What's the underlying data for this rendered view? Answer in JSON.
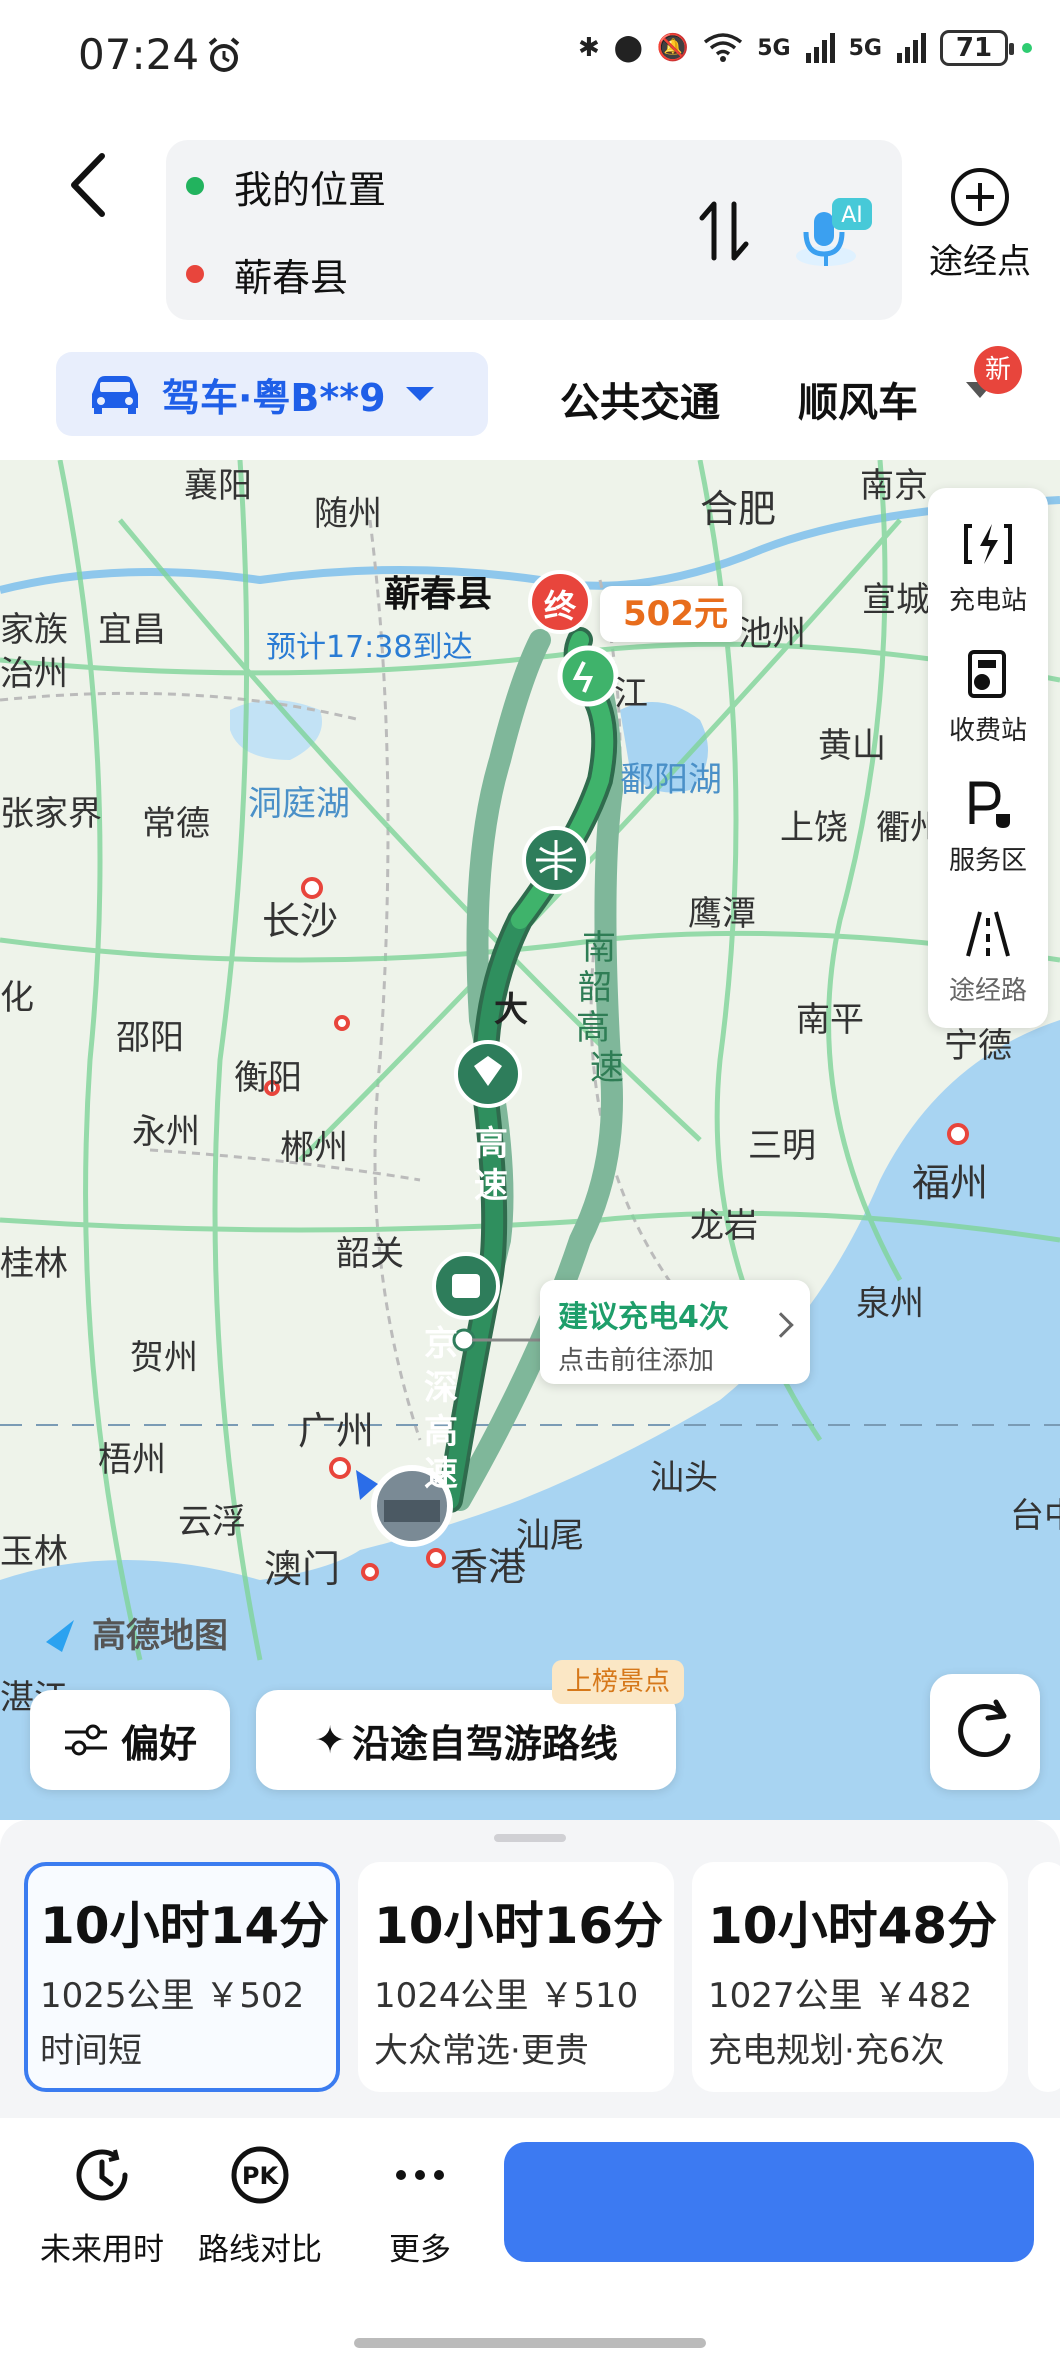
{
  "status_bar": {
    "time": "07:24",
    "network1": "5G",
    "network2": "5G",
    "battery": "71"
  },
  "search": {
    "origin": "我的位置",
    "destination": "蕲春县",
    "origin_color": "#22b35e",
    "destination_color": "#e8453c",
    "ai_label": "AI",
    "waypoint_label": "途经点"
  },
  "modes": {
    "drive": "驾车·粤B**9",
    "transit": "公共交通",
    "rideshare": "顺风车",
    "new_badge": "新"
  },
  "map": {
    "destination_name": "蕲春县",
    "eta": "预计17:38到达",
    "end_marker": "终",
    "toll": "502元",
    "charge_tip_title": "建议充电4次",
    "charge_tip_sub": "点击前往添加",
    "map_logo": "高德地图",
    "cities": {
      "xiangyang": "襄阳",
      "suizhou": "随州",
      "hefei": "合肥",
      "nanjing": "南京",
      "yichang": "宜昌",
      "xuancheng": "宣城",
      "chizhou": "池州",
      "jiujiang": "江",
      "huangshan": "黄山",
      "poyang": "鄱阳湖",
      "dongting": "洞庭湖",
      "zhangjiajie": "张家界",
      "changde": "常德",
      "changsha": "长沙",
      "shangrao": "上饶",
      "quzhou": "衢州",
      "yingtan": "鹰潭",
      "shaoyang": "邵阳",
      "hengyang": "衡阳",
      "yongzhou": "永州",
      "chenzhou": "郴州",
      "nanping": "南平",
      "ningde": "宁德",
      "sanming": "三明",
      "fuzhou": "福州",
      "longyan": "龙岩",
      "quanzhou": "泉州",
      "shaoguan": "韶关",
      "guilin": "桂林",
      "hezhou": "贺州",
      "guangzhou": "广州",
      "wuzhou": "梧州",
      "shantou": "汕头",
      "yunfu": "云浮",
      "macau": "澳门",
      "hongkong": "香港",
      "shanwei": "汕尾",
      "yulin": "玉林",
      "taizhong": "台中",
      "fragment_left1": "家族",
      "fragment_left2": "治州",
      "fragment_left3": "化",
      "fragment_zhanjiang": "湛江"
    },
    "road_labels": {
      "daguang": [
        "大",
        "高",
        "速"
      ],
      "nanshao": [
        "南",
        "韶",
        "高",
        "速"
      ],
      "jingshen": [
        "京",
        "深",
        "高",
        "速"
      ]
    }
  },
  "side_tools": [
    {
      "label": "充电站",
      "icon": "charging-station-icon"
    },
    {
      "label": "收费站",
      "icon": "toll-station-icon"
    },
    {
      "label": "服务区",
      "icon": "service-area-icon"
    },
    {
      "label": "途经路",
      "icon": "via-road-icon"
    }
  ],
  "actions": {
    "preference": "偏好",
    "tour_route": "沿途自驾游路线",
    "tour_badge": "上榜景点"
  },
  "routes": [
    {
      "duration": "10小时14分",
      "distance": "1025公里 ￥502",
      "tag": "时间短"
    },
    {
      "duration": "10小时16分",
      "distance": "1024公里 ￥510",
      "tag": "大众常选·更贵"
    },
    {
      "duration": "10小时48分",
      "distance": "1027公里 ￥482",
      "tag": "充电规划·充6次"
    }
  ],
  "bottom_bar": {
    "future": "未来用时",
    "compare": "路线对比",
    "more": "更多",
    "go_color": "#3c7af2"
  }
}
